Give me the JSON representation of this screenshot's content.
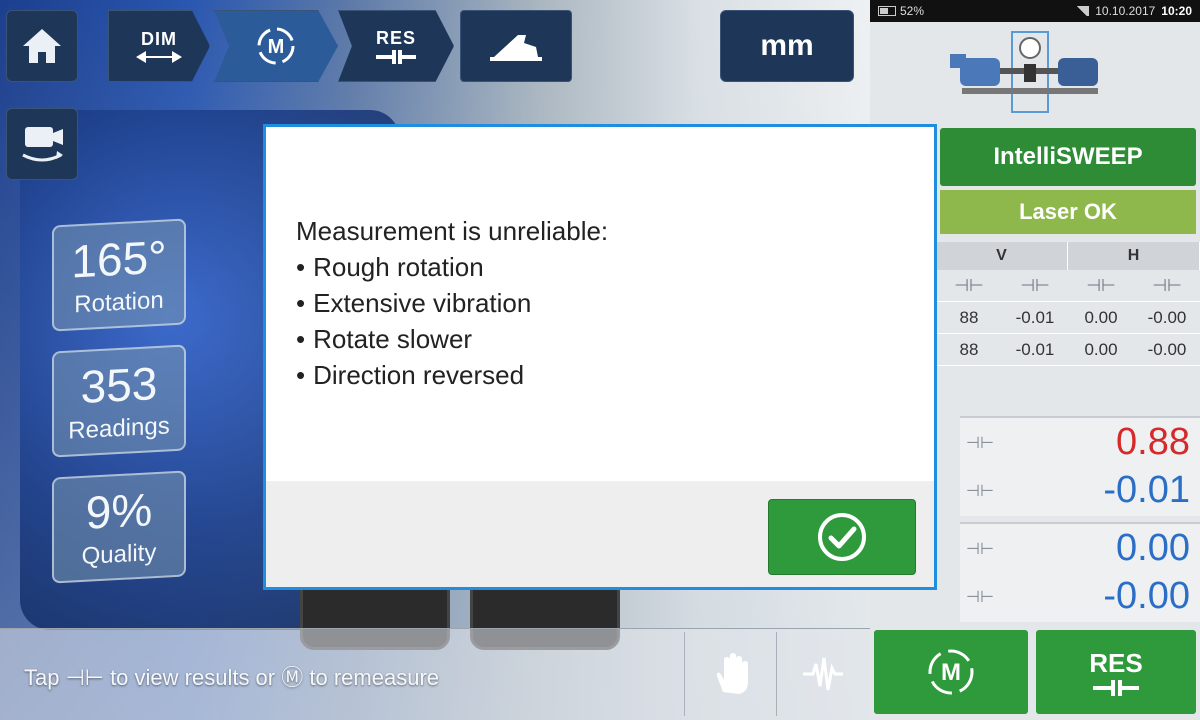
{
  "toolbar": {
    "dim_label": "DIM",
    "res_label": "RES",
    "unit_label": "mm"
  },
  "stats": {
    "rotation": {
      "value": "165°",
      "label": "Rotation"
    },
    "readings": {
      "value": "353",
      "label": "Readings"
    },
    "quality": {
      "value": "9%",
      "label": "Quality"
    }
  },
  "hint": {
    "part1": "Tap",
    "part2": "to view results or",
    "part3": "to remeasure"
  },
  "status_bar": {
    "battery": "52%",
    "date": "10.10.2017",
    "time": "10:20"
  },
  "right_panel": {
    "sweep_label": "IntelliSWEEP",
    "laser_label": "Laser OK",
    "table_headers": [
      "V",
      "H"
    ],
    "table_rows": [
      [
        "88",
        "-0.01",
        "0.00",
        "-0.00"
      ],
      [
        "88",
        "-0.01",
        "0.00",
        "-0.00"
      ]
    ],
    "vertical": {
      "offset": "0.88",
      "angle": "-0.01"
    },
    "horizontal": {
      "offset": "0.00",
      "angle": "-0.00"
    },
    "res_label": "RES"
  },
  "colors": {
    "accent_blue": "#1f8de0",
    "ok_green": "#2f9a3c",
    "laser_green": "#8fb84c",
    "value_red": "#d42a2a",
    "value_blue": "#2a6ec6"
  },
  "modal": {
    "title": "Measurement is unreliable:",
    "items": [
      "Rough rotation",
      "Extensive vibration",
      "Rotate slower",
      "Direction reversed"
    ],
    "ok_icon": "check-circle-icon"
  }
}
